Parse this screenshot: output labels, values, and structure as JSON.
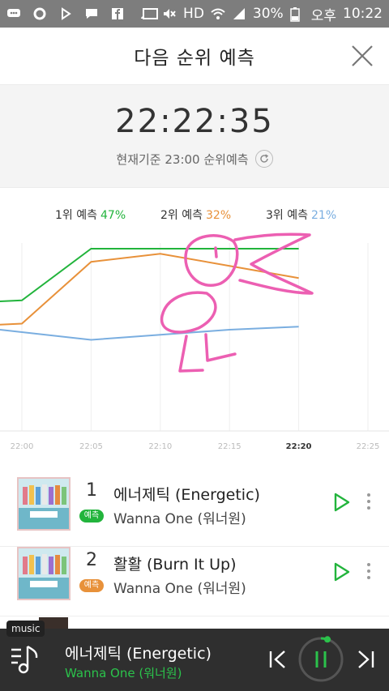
{
  "status_bar": {
    "battery": "30%",
    "ampm": "오후",
    "time": "10:22",
    "hd_label": "HD",
    "icons": [
      "chat-icon",
      "settings-icon",
      "play-icon",
      "message-icon",
      "facebook-icon",
      "cast-icon",
      "mute-icon",
      "hd-icon",
      "wifi-icon",
      "signal-icon",
      "battery-icon"
    ]
  },
  "header": {
    "title": "다음 순위 예측"
  },
  "time_panel": {
    "time": "22:22:35",
    "subtitle": "현재기준 23:00 순위예측"
  },
  "legend": [
    {
      "label": "1위 예측",
      "pct": "47%",
      "color": "#22b43c"
    },
    {
      "label": "2위 예측",
      "pct": "32%",
      "color": "#e8913a"
    },
    {
      "label": "3위 예측",
      "pct": "21%",
      "color": "#7aaee0"
    }
  ],
  "chart_data": {
    "type": "line",
    "x": [
      "22:00",
      "22:05",
      "22:10",
      "22:15",
      "22:20",
      "22:25"
    ],
    "xlim": [
      "22:00",
      "22:25"
    ],
    "x_ticks": [
      "22:00",
      "22:05",
      "22:10",
      "22:15",
      "22:20",
      "22:25"
    ],
    "highlight_tick": "22:20",
    "grid": true,
    "series": [
      {
        "name": "1위 예측",
        "color": "#22b43c",
        "points": [
          [
            "21:59",
            48
          ],
          [
            "22:00",
            49
          ],
          [
            "22:05",
            100
          ],
          [
            "22:10",
            100
          ],
          [
            "22:15",
            100
          ],
          [
            "22:20",
            100
          ]
        ]
      },
      {
        "name": "2위 예측",
        "color": "#e8913a",
        "points": [
          [
            "21:59",
            25
          ],
          [
            "22:00",
            26
          ],
          [
            "22:05",
            87
          ],
          [
            "22:10",
            95
          ],
          [
            "22:15",
            83
          ],
          [
            "22:20",
            71
          ]
        ]
      },
      {
        "name": "3위 예측",
        "color": "#7aaee0",
        "points": [
          [
            "21:59",
            20
          ],
          [
            "22:05",
            10
          ],
          [
            "22:10",
            15
          ],
          [
            "22:15",
            20
          ],
          [
            "22:20",
            23
          ]
        ]
      }
    ]
  },
  "songs": [
    {
      "rank": "1",
      "badge": "예측",
      "badge_color": "#22b43c",
      "title": "에너제틱 (Energetic)",
      "artist": "Wanna One (워너원)"
    },
    {
      "rank": "2",
      "badge": "예측",
      "badge_color": "#e8913a",
      "title": "활활 (Burn It Up)",
      "artist": "Wanna One (워너원)"
    }
  ],
  "player": {
    "tag": "music",
    "title": "에너제틱 (Energetic)",
    "artist": "Wanna One (워너원)",
    "progress": 0.05,
    "accent": "#2bc24b"
  }
}
